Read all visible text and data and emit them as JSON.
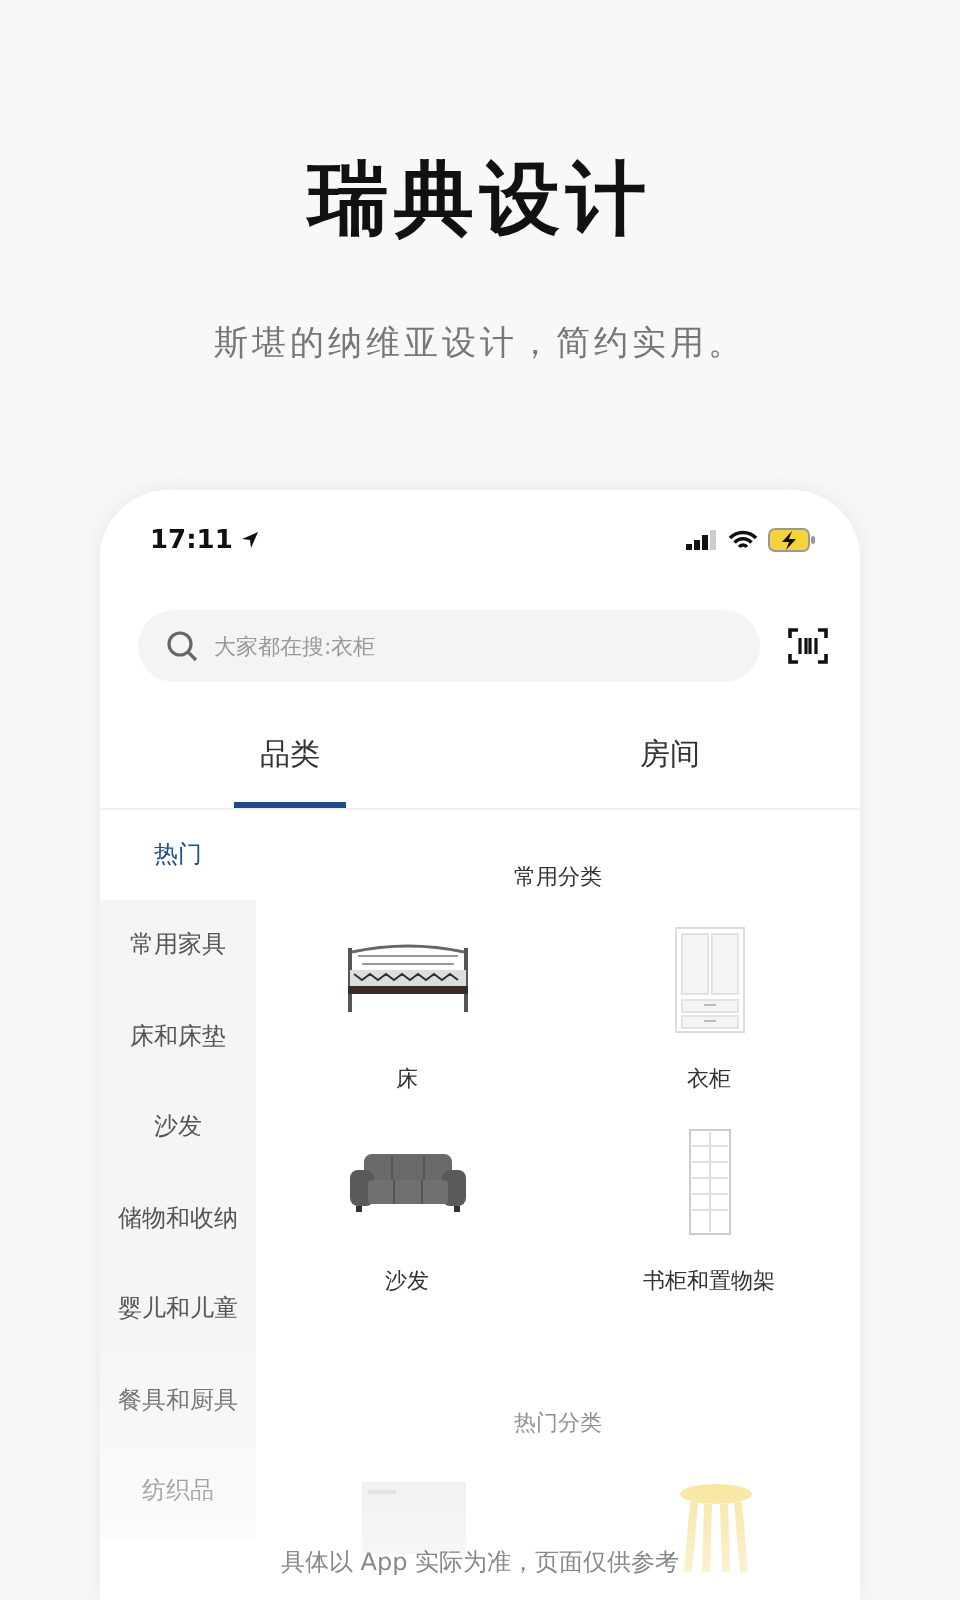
{
  "headline": "瑞典设计",
  "subtitle": "斯堪的纳维亚设计，简约实用。",
  "status_bar": {
    "time": "17:11"
  },
  "search": {
    "placeholder": "大家都在搜:衣柜"
  },
  "tabs": [
    {
      "label": "品类",
      "selected": true
    },
    {
      "label": "房间",
      "selected": false
    }
  ],
  "sidebar": {
    "items": [
      {
        "label": "热门",
        "selected": true
      },
      {
        "label": "常用家具",
        "selected": false
      },
      {
        "label": "床和床垫",
        "selected": false
      },
      {
        "label": "沙发",
        "selected": false
      },
      {
        "label": "储物和收纳",
        "selected": false
      },
      {
        "label": "婴儿和儿童",
        "selected": false
      },
      {
        "label": "餐具和厨具",
        "selected": false
      },
      {
        "label": "纺织品",
        "selected": false
      }
    ]
  },
  "common_section": {
    "title": "常用分类",
    "items": [
      {
        "label": "床",
        "kind": "bed"
      },
      {
        "label": "衣柜",
        "kind": "wardrobe"
      },
      {
        "label": "沙发",
        "kind": "sofa"
      },
      {
        "label": "书柜和置物架",
        "kind": "shelf"
      }
    ]
  },
  "hot_section": {
    "title": "热门分类"
  },
  "disclaimer": "具体以 App 实际为准，页面仅供参考"
}
